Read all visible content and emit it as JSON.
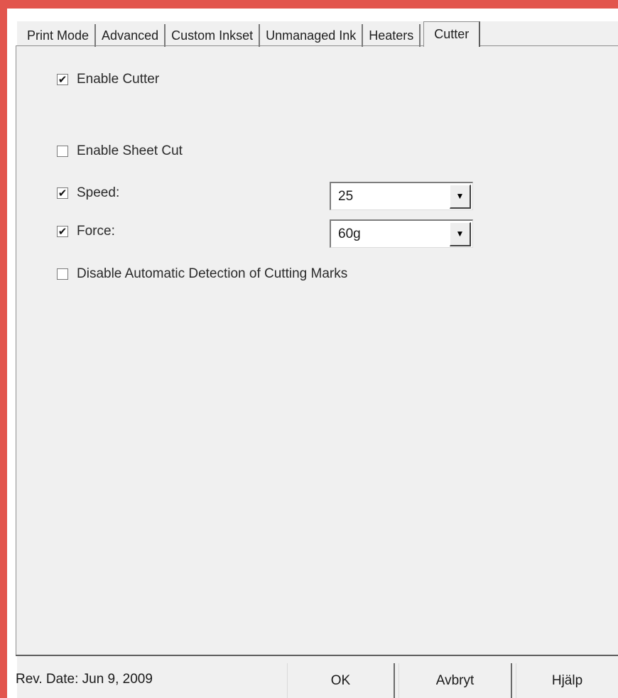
{
  "tabs": [
    {
      "label": "Print Mode"
    },
    {
      "label": "Advanced"
    },
    {
      "label": "Custom Inkset"
    },
    {
      "label": "Unmanaged Ink"
    },
    {
      "label": "Heaters"
    },
    {
      "label": "Cutter",
      "active": true
    }
  ],
  "options": {
    "enable_cutter": {
      "label": "Enable Cutter",
      "checked": true
    },
    "enable_sheet_cut": {
      "label": "Enable Sheet Cut",
      "checked": false
    },
    "speed": {
      "label": "Speed:",
      "checked": true,
      "value": "25"
    },
    "force": {
      "label": "Force:",
      "checked": true,
      "value": "60g"
    },
    "disable_detection": {
      "label": "Disable Automatic Detection of Cutting Marks",
      "checked": false
    }
  },
  "footer": {
    "rev_date": "Rev. Date: Jun 9, 2009",
    "ok_label": "OK",
    "cancel_label": "Avbryt",
    "help_label": "Hjälp"
  },
  "glyphs": {
    "check": "✔",
    "dropdown": "▼"
  },
  "colors": {
    "window_frame": "#e2554d",
    "dialog_background": "#f0f0f0"
  }
}
